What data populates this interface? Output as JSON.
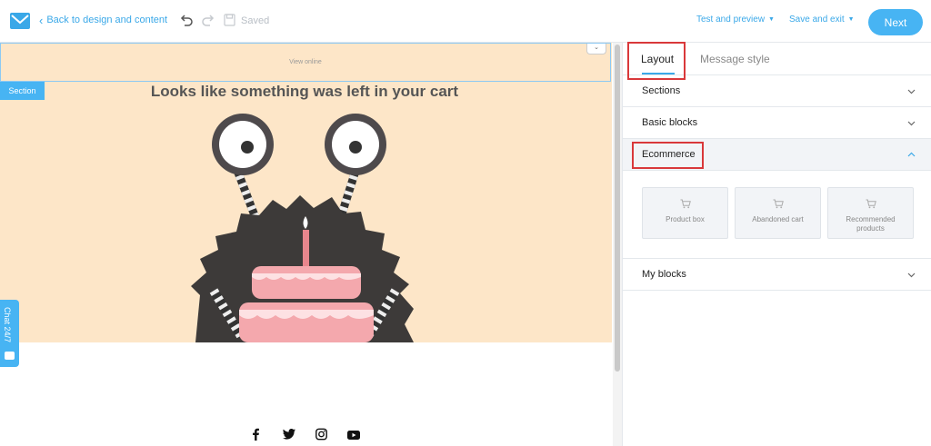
{
  "topbar": {
    "back_label": "Back to design and content",
    "saved_label": "Saved",
    "test_preview_label": "Test and preview",
    "save_exit_label": "Save and exit",
    "next_label": "Next"
  },
  "canvas": {
    "view_online": "View online",
    "section_tag": "Section",
    "headline": "Looks like something was left in your cart",
    "chat_label": "Chat 24/7"
  },
  "panel": {
    "tabs": {
      "layout": "Layout",
      "message_style": "Message style"
    },
    "sections_label": "Sections",
    "basic_blocks_label": "Basic blocks",
    "ecommerce_label": "Ecommerce",
    "blocks": [
      {
        "label": "Product box",
        "icon": "cart-icon"
      },
      {
        "label": "Abandoned cart",
        "icon": "cart-icon"
      },
      {
        "label": "Recommended products",
        "icon": "cart-icon"
      }
    ],
    "my_blocks_label": "My blocks"
  },
  "colors": {
    "accent": "#47b4f3",
    "banner_bg": "#fde6c8",
    "highlight": "#d9383a"
  }
}
